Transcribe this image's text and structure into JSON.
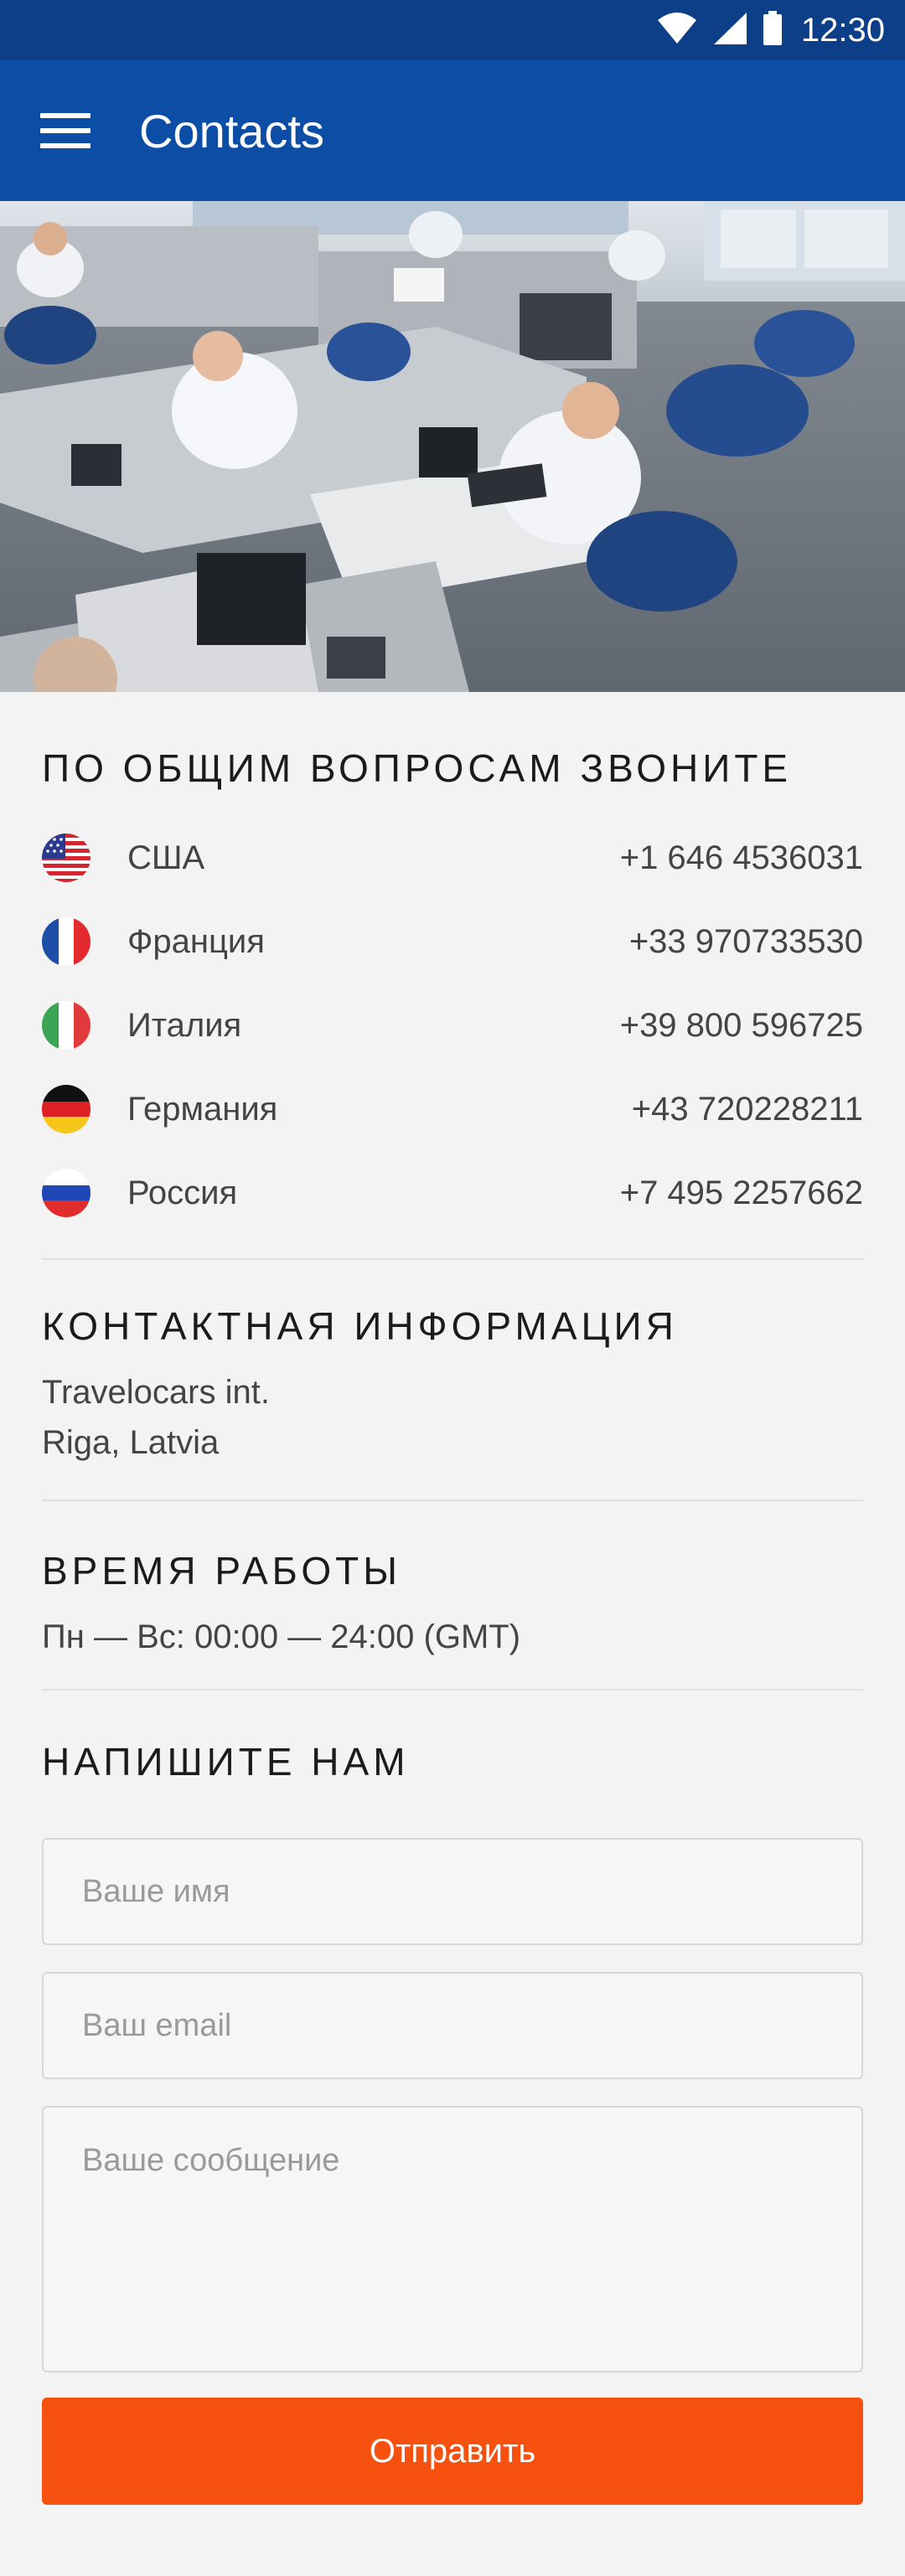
{
  "status_bar": {
    "time": "12:30",
    "icons": [
      "wifi-icon",
      "signal-icon",
      "battery-icon"
    ],
    "background": "#0d3f88"
  },
  "app_bar": {
    "title": "Contacts",
    "menu_icon": "hamburger-menu-icon",
    "background": "#0c4ea5"
  },
  "hero": {
    "image": "office-photo"
  },
  "phones": {
    "title": "ПО ОБЩИМ ВОПРОСАМ ЗВОНИТЕ",
    "items": [
      {
        "flag": "usa-flag-icon",
        "country": "США",
        "phone": "+1 646 4536031"
      },
      {
        "flag": "france-flag-icon",
        "country": "Франция",
        "phone": "+33 970733530"
      },
      {
        "flag": "italy-flag-icon",
        "country": "Италия",
        "phone": "+39 800 596725"
      },
      {
        "flag": "germany-flag-icon",
        "country": "Германия",
        "phone": "+43 720228211"
      },
      {
        "flag": "russia-flag-icon",
        "country": "Россия",
        "phone": "+7 495 2257662"
      }
    ]
  },
  "contact_info": {
    "title": "КОНТАКТНАЯ ИНФОРМАЦИЯ",
    "company": "Travelocars int.",
    "address": "Riga, Latvia"
  },
  "hours": {
    "title": "ВРЕМЯ РАБОТЫ",
    "text": "Пн — Вс: 00:00 — 24:00 (GMT)"
  },
  "contact_form": {
    "title": "НАПИШИТЕ НАМ",
    "name_placeholder": "Ваше имя",
    "name_value": "",
    "email_placeholder": "Ваш email",
    "email_value": "",
    "message_placeholder": "Ваше сообщение",
    "message_value": "",
    "submit_label": "Отправить",
    "accent": "#f7510f"
  }
}
